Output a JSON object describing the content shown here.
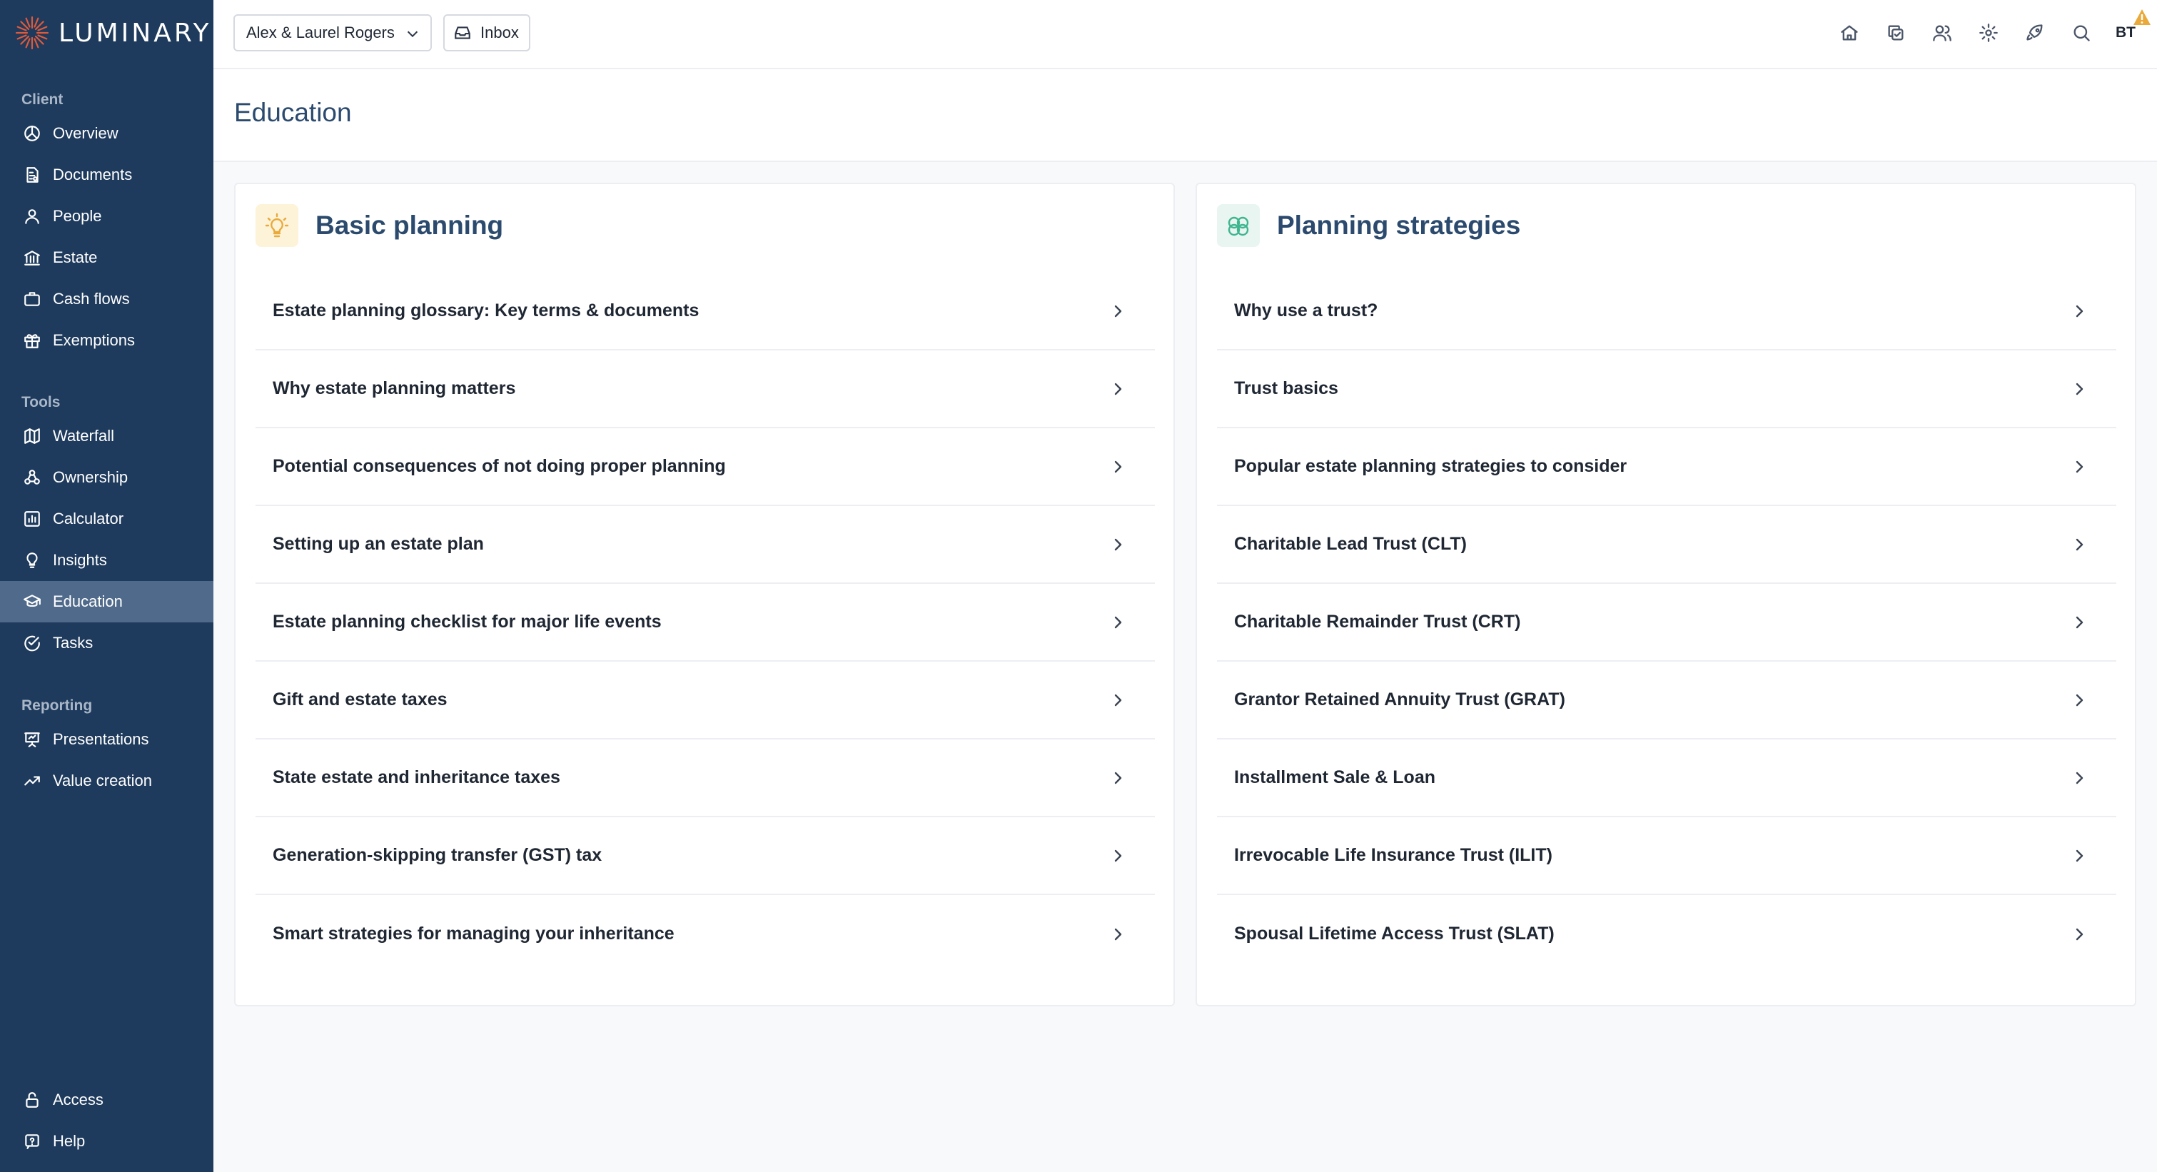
{
  "app": {
    "brand": "LUMINARY",
    "brand_color": "#e05a3a",
    "sidebar_bg": "#1e3a5c"
  },
  "sidebar": {
    "sections": [
      {
        "label": "Client",
        "items": [
          {
            "label": "Overview",
            "icon": "chart-pie-icon"
          },
          {
            "label": "Documents",
            "icon": "document-icon"
          },
          {
            "label": "People",
            "icon": "user-icon"
          },
          {
            "label": "Estate",
            "icon": "bank-icon"
          },
          {
            "label": "Cash flows",
            "icon": "briefcase-icon"
          },
          {
            "label": "Exemptions",
            "icon": "gift-icon"
          }
        ]
      },
      {
        "label": "Tools",
        "items": [
          {
            "label": "Waterfall",
            "icon": "map-icon"
          },
          {
            "label": "Ownership",
            "icon": "network-icon"
          },
          {
            "label": "Calculator",
            "icon": "bar-chart-icon"
          },
          {
            "label": "Insights",
            "icon": "lightbulb-icon"
          },
          {
            "label": "Education",
            "icon": "graduation-cap-icon",
            "active": true
          },
          {
            "label": "Tasks",
            "icon": "check-circle-icon"
          }
        ]
      },
      {
        "label": "Reporting",
        "items": [
          {
            "label": "Presentations",
            "icon": "presentation-icon"
          },
          {
            "label": "Value creation",
            "icon": "trend-up-icon"
          }
        ]
      }
    ],
    "footer_items": [
      {
        "label": "Access",
        "icon": "lock-icon"
      },
      {
        "label": "Help",
        "icon": "help-icon"
      }
    ]
  },
  "header": {
    "client_name": "Alex & Laurel Rogers",
    "inbox_label": "Inbox",
    "avatar_initials": "BT",
    "icons": [
      "home-icon",
      "copy-icon",
      "users-icon",
      "settings-icon",
      "rocket-icon",
      "search-icon"
    ],
    "warning_color": "#e9a93b"
  },
  "page": {
    "title": "Education"
  },
  "cards": {
    "basic": {
      "title": "Basic planning",
      "icon": "lightbulb-icon",
      "items": [
        "Estate planning glossary: Key terms & documents",
        "Why estate planning matters",
        "Potential consequences of not doing proper planning",
        "Setting up an estate plan",
        "Estate planning checklist for major life events",
        "Gift and estate taxes",
        "State estate and inheritance taxes",
        "Generation-skipping transfer (GST) tax",
        "Smart strategies for managing your inheritance"
      ]
    },
    "strategies": {
      "title": "Planning strategies",
      "icon": "chain-link-icon",
      "items": [
        "Why use a trust?",
        "Trust basics",
        "Popular estate planning strategies to consider",
        "Charitable Lead Trust (CLT)",
        "Charitable Remainder Trust (CRT)",
        "Grantor Retained Annuity Trust (GRAT)",
        "Installment Sale & Loan",
        "Irrevocable Life Insurance Trust (ILIT)",
        "Spousal Lifetime Access Trust (SLAT)"
      ]
    }
  }
}
